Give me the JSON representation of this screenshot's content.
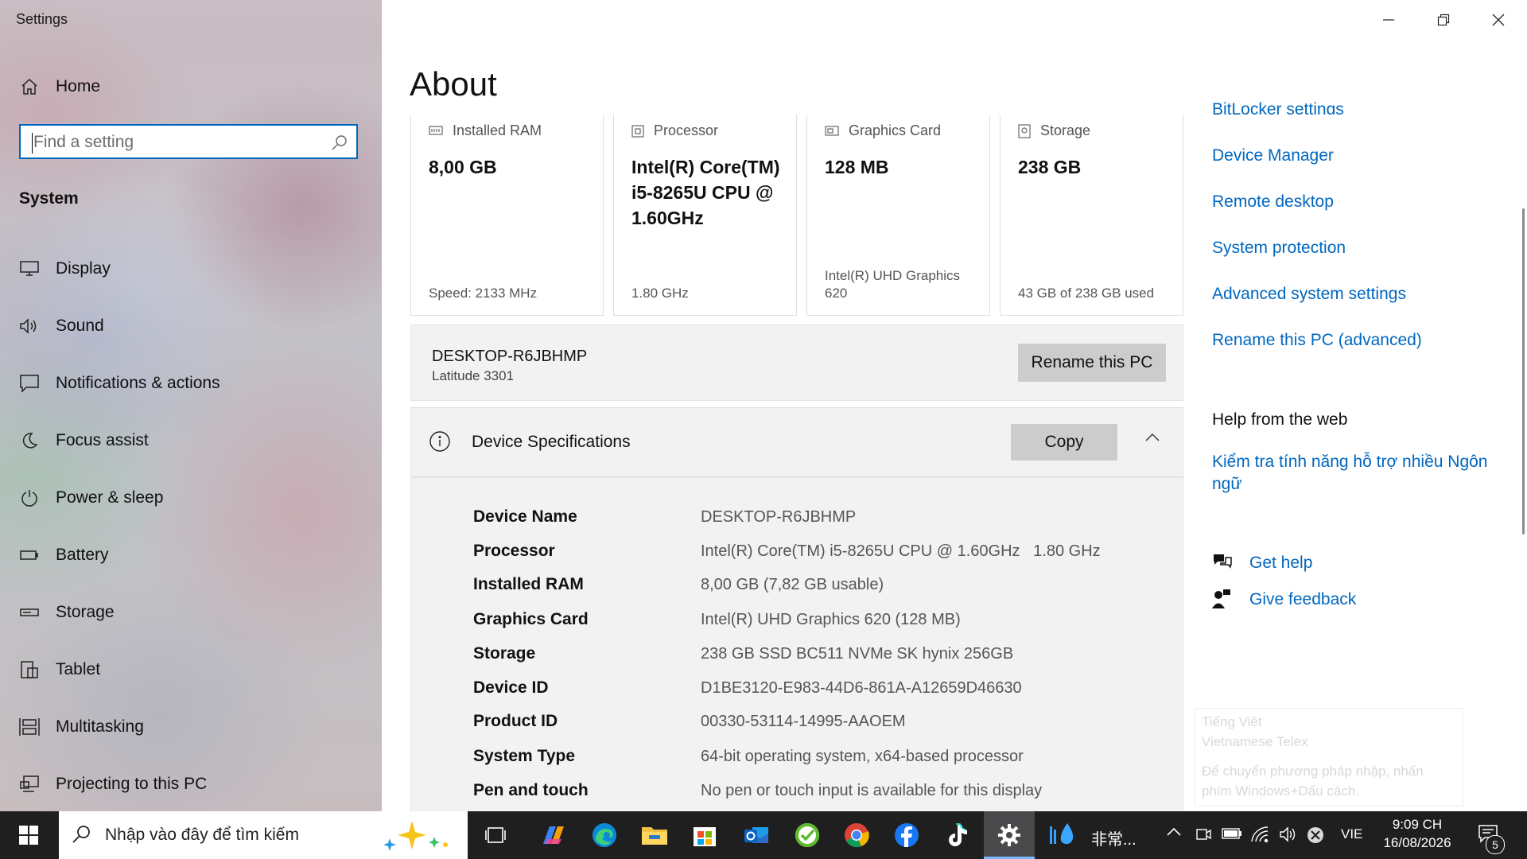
{
  "window": {
    "app_title": "Settings"
  },
  "sidebar": {
    "home_label": "Home",
    "search_placeholder": "Find a setting",
    "section_title": "System",
    "items": [
      {
        "label": "Display",
        "icon": "monitor-icon"
      },
      {
        "label": "Sound",
        "icon": "speaker-icon"
      },
      {
        "label": "Notifications & actions",
        "icon": "notification-icon"
      },
      {
        "label": "Focus assist",
        "icon": "moon-icon"
      },
      {
        "label": "Power & sleep",
        "icon": "power-icon"
      },
      {
        "label": "Battery",
        "icon": "battery-icon"
      },
      {
        "label": "Storage",
        "icon": "storage-icon"
      },
      {
        "label": "Tablet",
        "icon": "tablet-icon"
      },
      {
        "label": "Multitasking",
        "icon": "multitasking-icon"
      },
      {
        "label": "Projecting to this PC",
        "icon": "projecting-icon"
      }
    ]
  },
  "main": {
    "title": "About",
    "cards": [
      {
        "label": "Installed RAM",
        "value": "8,00 GB",
        "sub": "Speed: 2133 MHz",
        "icon": "ram-icon"
      },
      {
        "label": "Processor",
        "value": "Intel(R) Core(TM) i5-8265U CPU @ 1.60GHz",
        "sub": "1.80 GHz",
        "icon": "processor-icon"
      },
      {
        "label": "Graphics Card",
        "value": "128 MB",
        "sub": "Intel(R) UHD Graphics 620",
        "icon": "graphics-card-icon"
      },
      {
        "label": "Storage",
        "value": "238 GB",
        "sub": "43 GB of 238 GB used",
        "icon": "storage-drive-icon"
      }
    ],
    "pc": {
      "name": "DESKTOP-R6JBHMP",
      "model": "Latitude 3301",
      "rename_button": "Rename this PC"
    },
    "specs": {
      "title": "Device Specifications",
      "copy_button": "Copy",
      "rows": [
        {
          "key": "Device Name",
          "value": "DESKTOP-R6JBHMP"
        },
        {
          "key": "Processor",
          "value": "Intel(R) Core(TM) i5-8265U CPU @ 1.60GHz   1.80 GHz"
        },
        {
          "key": "Installed RAM",
          "value": "8,00 GB (7,82 GB usable)"
        },
        {
          "key": "Graphics Card",
          "value": "Intel(R) UHD Graphics 620 (128 MB)"
        },
        {
          "key": "Storage",
          "value": "238 GB SSD BC511 NVMe SK hynix 256GB"
        },
        {
          "key": "Device ID",
          "value": "D1BE3120-E983-44D6-861A-A12659D46630"
        },
        {
          "key": "Product ID",
          "value": "00330-53114-14995-AAOEM"
        },
        {
          "key": "System Type",
          "value": "64-bit operating system, x64-based processor"
        },
        {
          "key": "Pen and touch",
          "value": "No pen or touch input is available for this display"
        }
      ]
    }
  },
  "related": {
    "partial_link": "BitLocker settings",
    "links": [
      "Device Manager",
      "Remote desktop",
      "System protection",
      "Advanced system settings",
      "Rename this PC (advanced)"
    ],
    "help_title": "Help from the web",
    "help_link": "Kiểm tra tính năng hỗ trợ nhiều Ngôn ngữ",
    "get_help": "Get help",
    "give_feedback": "Give feedback"
  },
  "ime_popup": {
    "line1": "Tiếng Việt",
    "line2": "Vietnamese Telex",
    "line3": "Để chuyển phương pháp nhập, nhấn",
    "line4": "phím Windows+Dấu cách."
  },
  "taskbar": {
    "search_placeholder": "Nhập vào đây để tìm kiếm",
    "pinned": [
      "task-view-icon",
      "copilot-icon",
      "edge-icon",
      "file-explorer-icon",
      "microsoft-store-icon",
      "outlook-icon",
      "green-app-icon",
      "chrome-icon",
      "facebook-icon",
      "tiktok-icon",
      "settings-icon"
    ],
    "running_app_label": "非常...",
    "language": "VIE",
    "time": "9:09 CH",
    "date": "16/08/2026",
    "notification_count": "5"
  },
  "colors": {
    "accent": "#0067c0",
    "taskbar": "#1f1f20",
    "panel": "#f2f2f2",
    "button": "#cccccc"
  }
}
